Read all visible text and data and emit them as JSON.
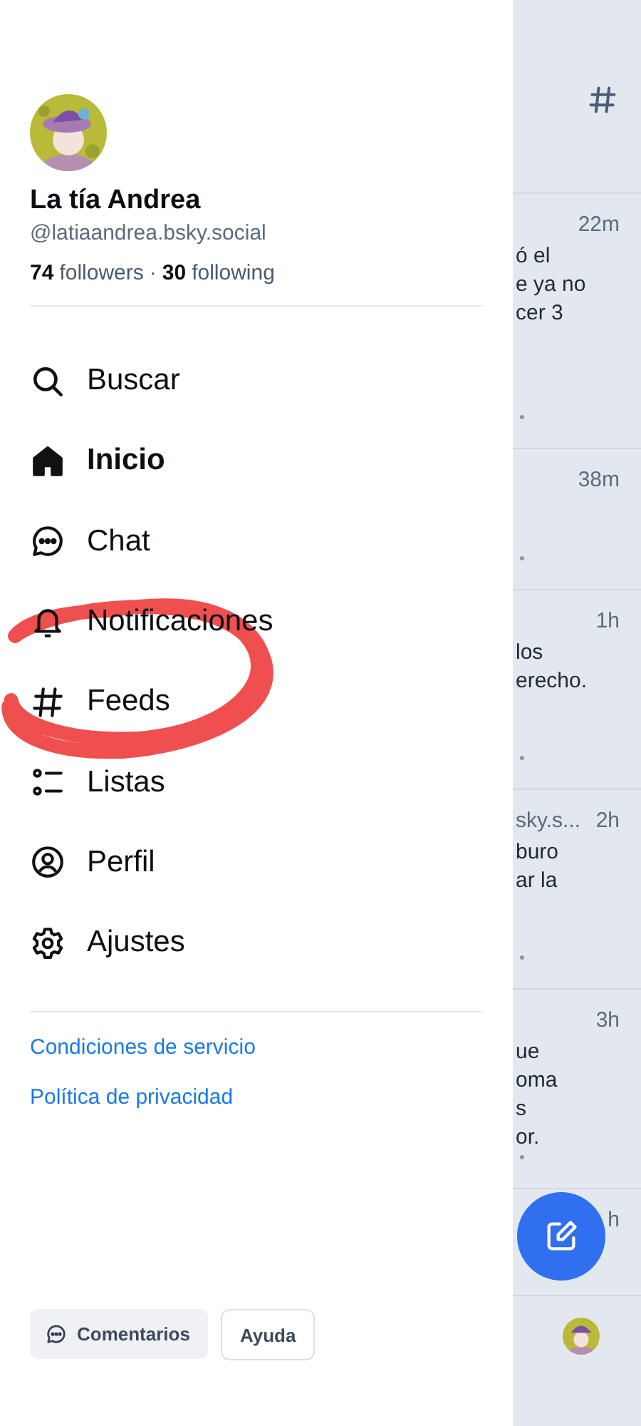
{
  "profile": {
    "name": "La tía Andrea",
    "handle": "@latiaandrea.bsky.social",
    "followers_count": "74",
    "followers_label": "followers",
    "separator": "·",
    "following_count": "30",
    "following_label": "following"
  },
  "menu": [
    {
      "label": "Buscar",
      "selected": false
    },
    {
      "label": "Inicio",
      "selected": true
    },
    {
      "label": "Chat",
      "selected": false
    },
    {
      "label": "Notificaciones",
      "selected": false
    },
    {
      "label": "Feeds",
      "selected": false
    },
    {
      "label": "Listas",
      "selected": false
    },
    {
      "label": "Perfil",
      "selected": false
    },
    {
      "label": "Ajustes",
      "selected": false
    }
  ],
  "links": [
    "Condiciones de servicio",
    "Política de privacidad"
  ],
  "footer_buttons": [
    {
      "kind": "feedback",
      "label": "Comentarios"
    },
    {
      "kind": "plain",
      "label": "Ayuda"
    }
  ],
  "feed_posts": [
    {
      "time": "22m",
      "lines": [
        "ó el",
        "e ya no",
        "cer 3"
      ]
    },
    {
      "time": "38m"
    },
    {
      "time": "1h",
      "lines": [
        "los",
        "erecho."
      ]
    },
    {
      "author": "sky.s...",
      "time": "2h",
      "lines": [
        "buro",
        "ar la"
      ]
    },
    {
      "time": "3h",
      "lines": [
        "ue",
        "oma",
        "s",
        "or."
      ]
    },
    {
      "time": "h"
    }
  ]
}
